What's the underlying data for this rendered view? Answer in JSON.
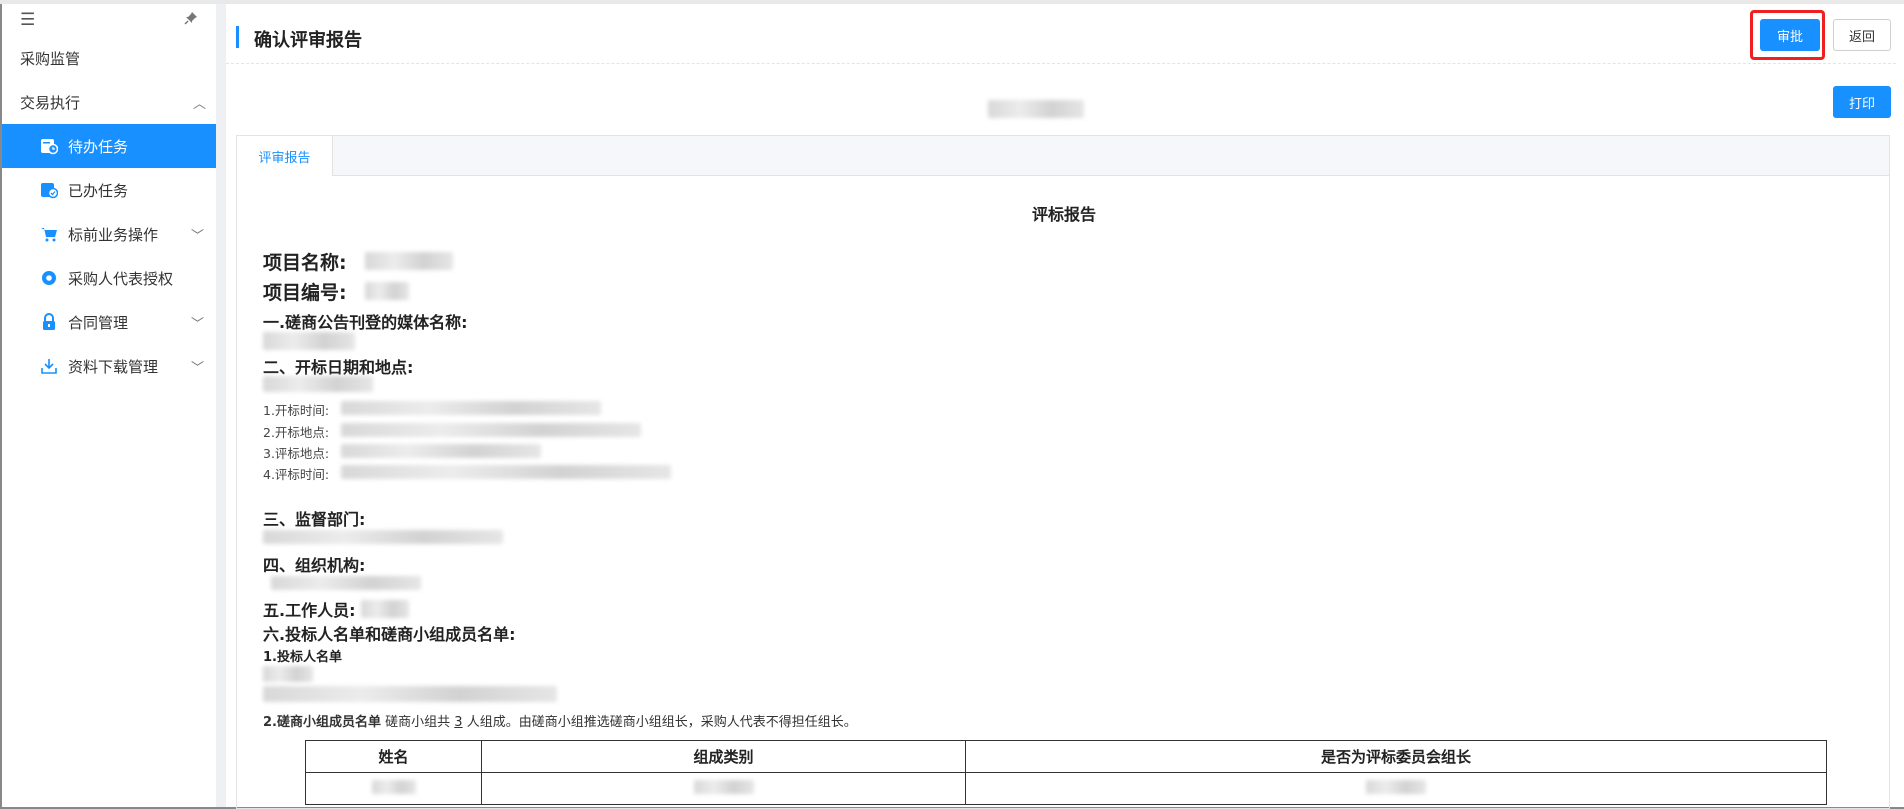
{
  "sidebar": {
    "menu_icon": "hamburger-icon",
    "pin_icon": "pin-icon",
    "groups": [
      {
        "label": "采购监管"
      },
      {
        "label": "交易执行"
      }
    ],
    "items": [
      {
        "label": "待办任务",
        "icon": "todo-task-icon",
        "active": true
      },
      {
        "label": "已办任务",
        "icon": "done-task-icon"
      },
      {
        "label": "标前业务操作",
        "icon": "cart-icon"
      },
      {
        "label": "采购人代表授权",
        "icon": "gear-icon"
      },
      {
        "label": "合同管理",
        "icon": "lock-icon"
      },
      {
        "label": "资料下载管理",
        "icon": "download-icon"
      }
    ]
  },
  "header": {
    "title": "确认评审报告",
    "approve_label": "审批",
    "back_label": "返回",
    "print_label": "打印"
  },
  "tabs": [
    {
      "label": "评审报告"
    }
  ],
  "report": {
    "title": "评标报告",
    "project_name_label": "项目名称:",
    "project_no_label": "项目编号:",
    "section1": "一.磋商公告刊登的媒体名称:",
    "section2": "二、开标日期和地点:",
    "details": [
      {
        "label": "1.开标时间:"
      },
      {
        "label": "2.开标地点:"
      },
      {
        "label": "3.评标地点:"
      },
      {
        "label": "4.评标时间:"
      }
    ],
    "section3": "三、监督部门:",
    "section4": "四、组织机构:",
    "section5": "五.工作人员:",
    "section6": "六.投标人名单和磋商小组成员名单:",
    "bidders_heading": "1.投标人名单",
    "members_heading": "2.磋商小组成员名单",
    "members_note_prefix": "磋商小组共",
    "members_count": "3",
    "members_note_suffix": "人组成。由磋商小组推选磋商小组组长，采购人代表不得担任组长。",
    "table_headers": [
      "姓名",
      "组成类别",
      "是否为评标委员会组长"
    ]
  },
  "colors": {
    "accent": "#1890ff",
    "highlight": "#f02020"
  }
}
